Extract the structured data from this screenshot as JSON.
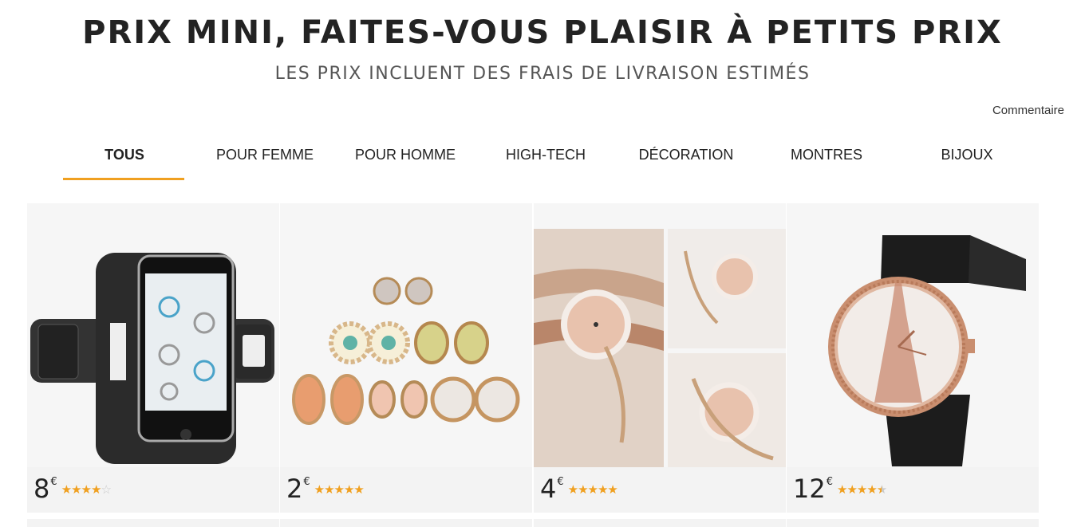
{
  "header": {
    "title": "PRIX MINI, FAITES-VOUS PLAISIR À PETITS PRIX",
    "subtitle": "LES PRIX INCLUENT DES FRAIS DE LIVRAISON ESTIMÉS",
    "feedback": "Commentaire"
  },
  "tabs": [
    {
      "label": "TOUS",
      "active": true
    },
    {
      "label": "POUR FEMME",
      "active": false
    },
    {
      "label": "POUR HOMME",
      "active": false
    },
    {
      "label": "HIGH-TECH",
      "active": false
    },
    {
      "label": "DÉCORATION",
      "active": false
    },
    {
      "label": "MONTRES",
      "active": false
    },
    {
      "label": "BIJOUX",
      "active": false
    }
  ],
  "products": [
    {
      "price": "8",
      "currency": "€",
      "rating": 4,
      "rating_max": 5,
      "image": "phone-armband-image"
    },
    {
      "price": "2",
      "currency": "€",
      "rating": 5,
      "rating_max": 5,
      "image": "earrings-set-image"
    },
    {
      "price": "4",
      "currency": "€",
      "rating": 5,
      "rating_max": 5,
      "image": "bracelet-watch-image"
    },
    {
      "price": "12",
      "currency": "€",
      "rating": 4.5,
      "rating_max": 5,
      "image": "eiffel-watch-image"
    }
  ],
  "colors": {
    "accent": "#f0a020",
    "card_bg": "#f3f3f3",
    "title": "#232323"
  }
}
